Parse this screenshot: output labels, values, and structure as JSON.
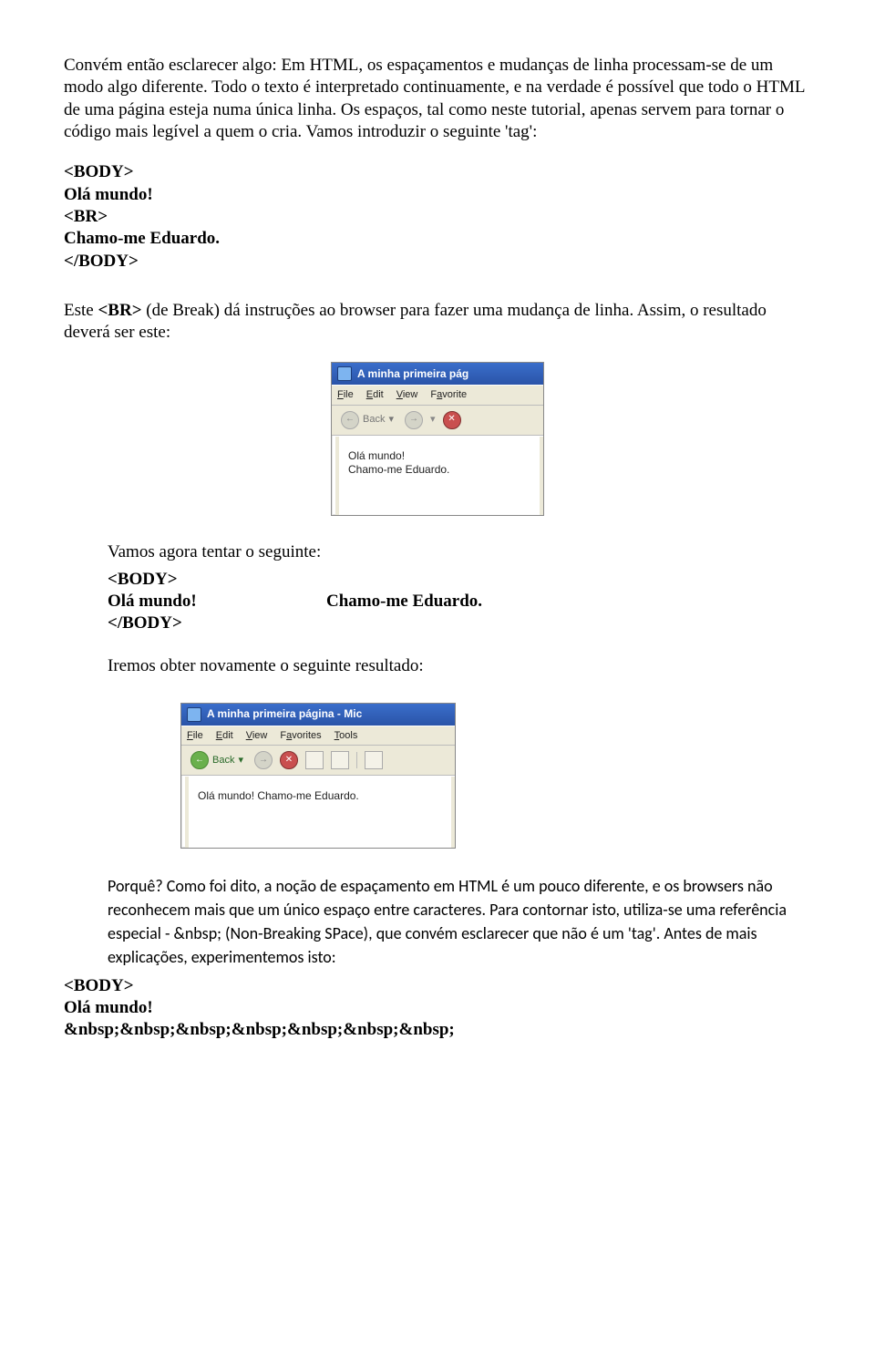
{
  "para1": "Convém então esclarecer algo: Em HTML, os espaçamentos e mudanças de linha processam-se de um modo algo diferente. Todo o texto é interpretado continuamente, e na verdade é possível que todo o HTML de uma página esteja numa única linha. Os espaços, tal como neste tutorial, apenas servem para tornar o código mais legível a quem o cria. Vamos introduzir o seguinte 'tag':",
  "code1": {
    "l1": "<BODY>",
    "l2": "Olá mundo!",
    "l3": "<BR>",
    "l4": "Chamo-me Eduardo.",
    "l5": "</BODY>"
  },
  "para2a": "Este ",
  "para2b": "<BR>",
  "para2c": " (de Break) dá instruções ao browser para fazer uma mudança de linha. Assim, o resultado deverá ser este:",
  "shot1": {
    "title": "A minha primeira pág",
    "menus": {
      "file": "File",
      "edit": "Edit",
      "view": "View",
      "fav": "Favorite"
    },
    "back": "Back",
    "content_l1": "Olá mundo!",
    "content_l2": "Chamo-me Eduardo."
  },
  "indent": {
    "p1": "Vamos agora tentar o seguinte:",
    "code": {
      "l1": "<BODY>",
      "l2a": "Olá mundo!",
      "l2b": "Chamo-me Eduardo.",
      "l3": "</BODY>"
    },
    "p2": "Iremos obter novamente o seguinte resultado:"
  },
  "shot2": {
    "title": "A minha primeira página - Mic",
    "menus": {
      "file": "File",
      "edit": "Edit",
      "view": "View",
      "fav": "Favorites",
      "tools": "Tools"
    },
    "back": "Back",
    "content": "Olá mundo! Chamo-me Eduardo."
  },
  "calibri_para": "Porquê? Como foi dito, a noção de espaçamento em HTML é um pouco diferente, e os browsers não reconhecem mais que um único espaço entre caracteres. Para contornar isto, utiliza-se uma referência especial - &nbsp; (Non-Breaking SPace), que convém esclarecer que não é um 'tag'. Antes de mais explicações, experimentemos isto:",
  "code3": {
    "l1": "<BODY>",
    "l2": "Olá mundo!",
    "l3": "&nbsp;&nbsp;&nbsp;&nbsp;&nbsp;&nbsp;&nbsp;"
  }
}
